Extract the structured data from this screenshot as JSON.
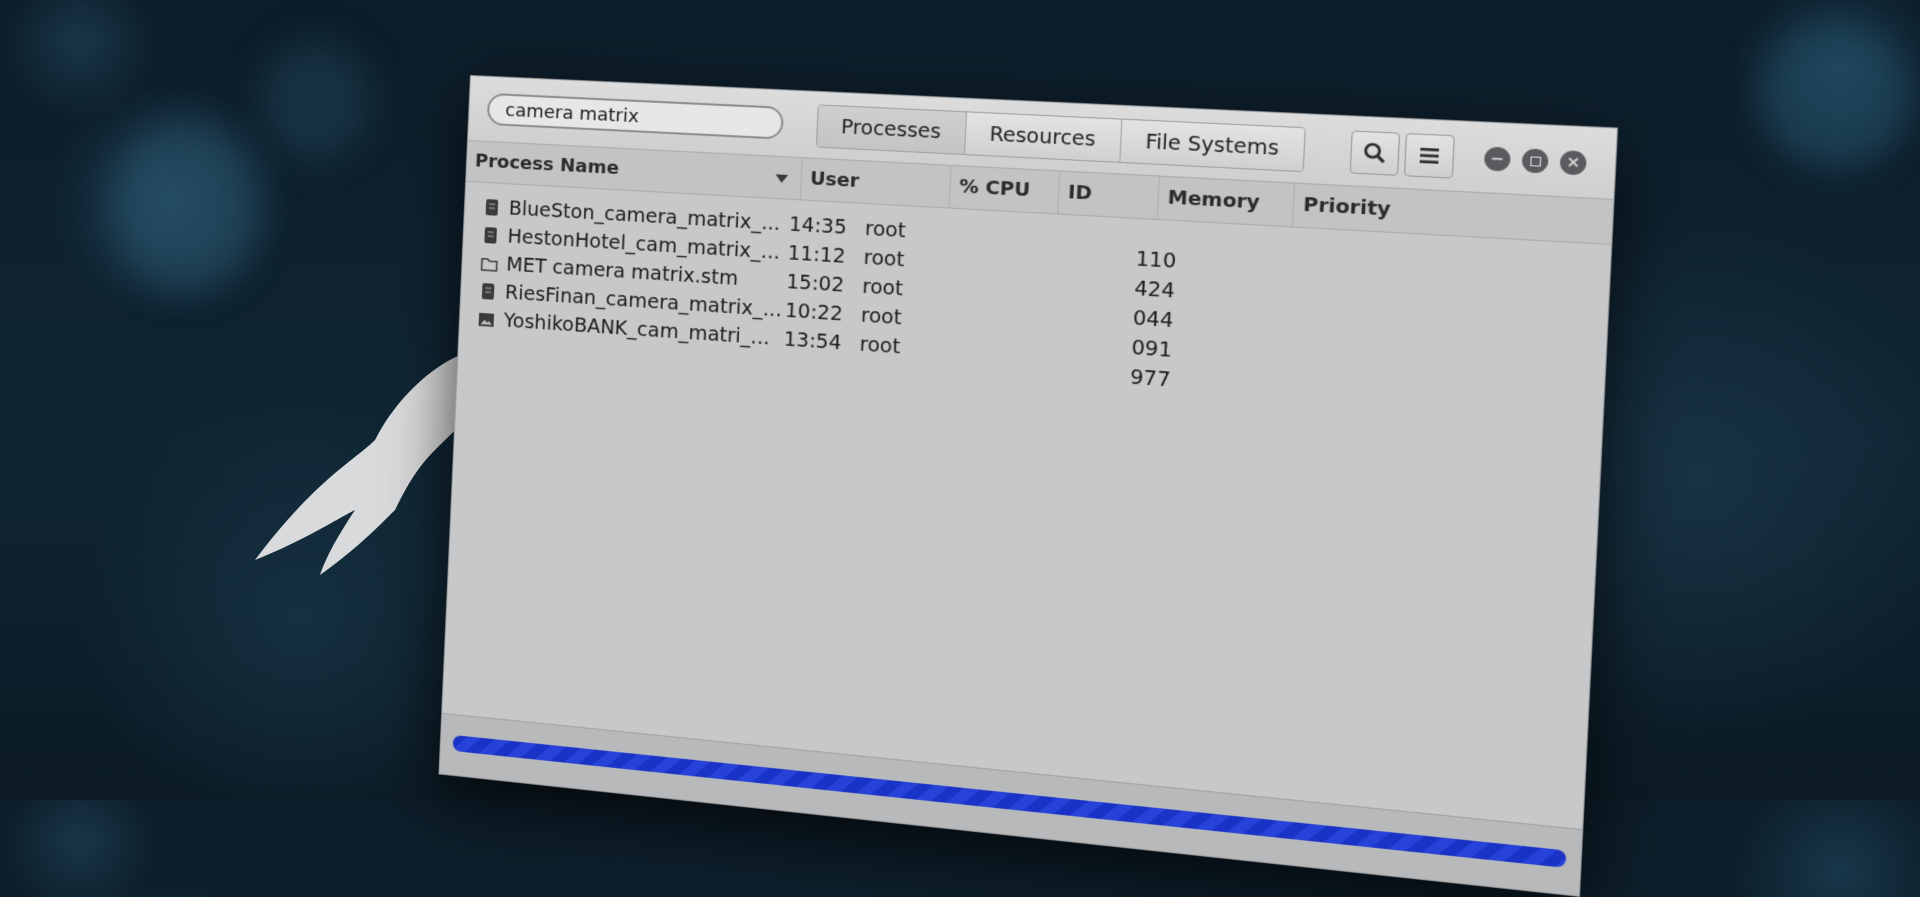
{
  "search": {
    "value": "camera matrix"
  },
  "tabs": [
    {
      "label": "Processes"
    },
    {
      "label": "Resources"
    },
    {
      "label": "File Systems"
    }
  ],
  "toolbar": {
    "icons": [
      "search-icon",
      "menu-icon",
      "minimize-icon",
      "maximize-icon",
      "close-icon"
    ]
  },
  "columns": {
    "process_name": "Process Name",
    "user": "User",
    "cpu": "% CPU",
    "id": "ID",
    "memory": "Memory",
    "priority": "Priority"
  },
  "rows": [
    {
      "icon": "document-icon",
      "name": "BlueSton_camera_matrix_...",
      "time": "14:35",
      "user": "root"
    },
    {
      "icon": "document-icon",
      "name": "HestonHotel_cam_matrix_...",
      "time": "11:12",
      "user": "root"
    },
    {
      "icon": "folder-icon",
      "name": "MET camera matrix.stm",
      "time": "15:02",
      "user": "root"
    },
    {
      "icon": "document-icon",
      "name": "RiesFinan_camera_matrix_...",
      "time": "10:22",
      "user": "root"
    },
    {
      "icon": "image-icon",
      "name": "YoshikoBANK_cam_matri_...",
      "time": "13:54",
      "user": "root"
    }
  ],
  "ids": [
    "110",
    "424",
    "044",
    "091",
    "977"
  ],
  "progress": {
    "fraction": 1.0,
    "color": "#1f3ad0"
  },
  "colors": {
    "window_bg": "#c7c8ca",
    "desktop_bg": "#0f2533",
    "accent_blue": "#1f3ad0"
  }
}
